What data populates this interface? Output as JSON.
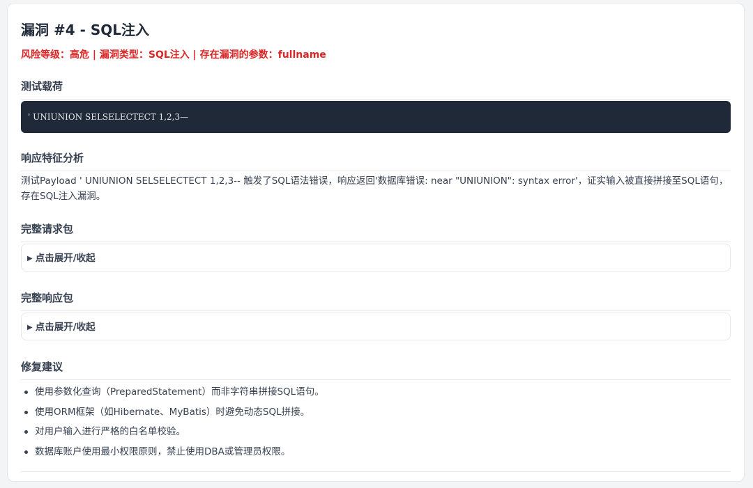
{
  "vuln": {
    "title": "漏洞 #4 - SQL注入",
    "risk_line": "风险等级：高危 | 漏洞类型：SQL注入 | 存在漏洞的参数：fullname"
  },
  "sections": {
    "payload": {
      "heading": "测试载荷",
      "code": "' UNIUNION SELSELECTECT 1,2,3—"
    },
    "analysis": {
      "heading": "响应特征分析",
      "text": "测试Payload ' UNIUNION SELSELECTECT 1,2,3-- 触发了SQL语法错误，响应返回'数据库错误: near \"UNIUNION\": syntax error'，证实输入被直接拼接至SQL语句，存在SQL注入漏洞。"
    },
    "request": {
      "heading": "完整请求包",
      "toggle": "点击展开/收起"
    },
    "response": {
      "heading": "完整响应包",
      "toggle": "点击展开/收起"
    },
    "fix": {
      "heading": "修复建议",
      "items": [
        "使用参数化查询（PreparedStatement）而非字符串拼接SQL语句。",
        "使用ORM框架（如Hibernate、MyBatis）时避免动态SQL拼接。",
        "对用户输入进行严格的白名单校验。",
        "数据库账户使用最小权限原则，禁止使用DBA或管理员权限。"
      ]
    }
  },
  "colors": {
    "risk": "#dc2626",
    "code_bg": "#1f2937",
    "border": "#e5e7eb"
  }
}
